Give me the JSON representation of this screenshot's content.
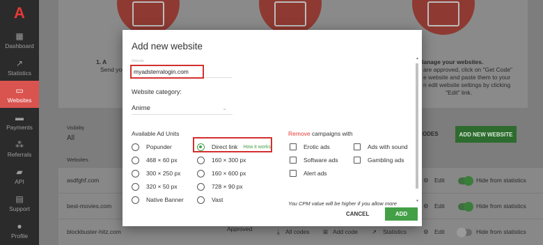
{
  "sidebar": {
    "logo": "A",
    "items": [
      {
        "label": "Dashboard",
        "icon": "▦"
      },
      {
        "label": "Statistics",
        "icon": "↗"
      },
      {
        "label": "Websites",
        "icon": "▭"
      },
      {
        "label": "Payments",
        "icon": "▬"
      },
      {
        "label": "Referrals",
        "icon": "⁂"
      },
      {
        "label": "API",
        "icon": "▰"
      },
      {
        "label": "Support",
        "icon": "▤"
      },
      {
        "label": "Profile",
        "icon": "●"
      }
    ]
  },
  "background": {
    "left_heading": "1. A",
    "left_text": "Send you",
    "right_heading": "lanage your websites.",
    "right_lines": [
      " are approved, click on \"Get Code\"",
      "e website and paste them to your",
      "n edit website settings by clicking",
      "\"Edit\" link."
    ],
    "visibility_label": "Visibility",
    "visibility_value": "All",
    "websites_label": "Websites",
    "codes_text": "T CODES",
    "add_new_button": "ADD NEW WEBSITE",
    "rows": [
      {
        "site": "asdfghf.com",
        "edit": "Edit",
        "hide": "Hide from statistics"
      },
      {
        "site": "best-movies.com",
        "edit": "Edit",
        "hide": "Hide from statistics"
      },
      {
        "site": "blockbuster-hitz.com",
        "status": "Approved",
        "all_codes": "All codes",
        "add_code": "Add code",
        "stats": "Statistics",
        "edit": "Edit",
        "hide": "Hide from statistics"
      }
    ]
  },
  "modal": {
    "title": "Add new website",
    "url_label": "Website",
    "url_value": "myadsterralogin.com",
    "category_label": "Website category:",
    "category_value": "Anime",
    "ad_units_title": "Available Ad Units",
    "ad_units_col1": [
      "Popunder",
      "468 × 60 px",
      "300 × 250 px",
      "320 × 50 px",
      "Native Banner"
    ],
    "ad_units_col2": [
      "Direct link",
      "160 × 300 px",
      "160 × 600 px",
      "728 × 90 px",
      "Vast"
    ],
    "how_it_works": "How it works",
    "remove_word": "Remove",
    "remove_rest": " campaigns with",
    "campaigns_col1": [
      "Erotic ads",
      "Software ads",
      "Alert ads"
    ],
    "campaigns_col2": [
      "Ads with sound",
      "Gambling ads"
    ],
    "cpm_note": "You CPM value will be higher if you allow more",
    "cancel": "CANCEL",
    "add": "ADD"
  }
}
